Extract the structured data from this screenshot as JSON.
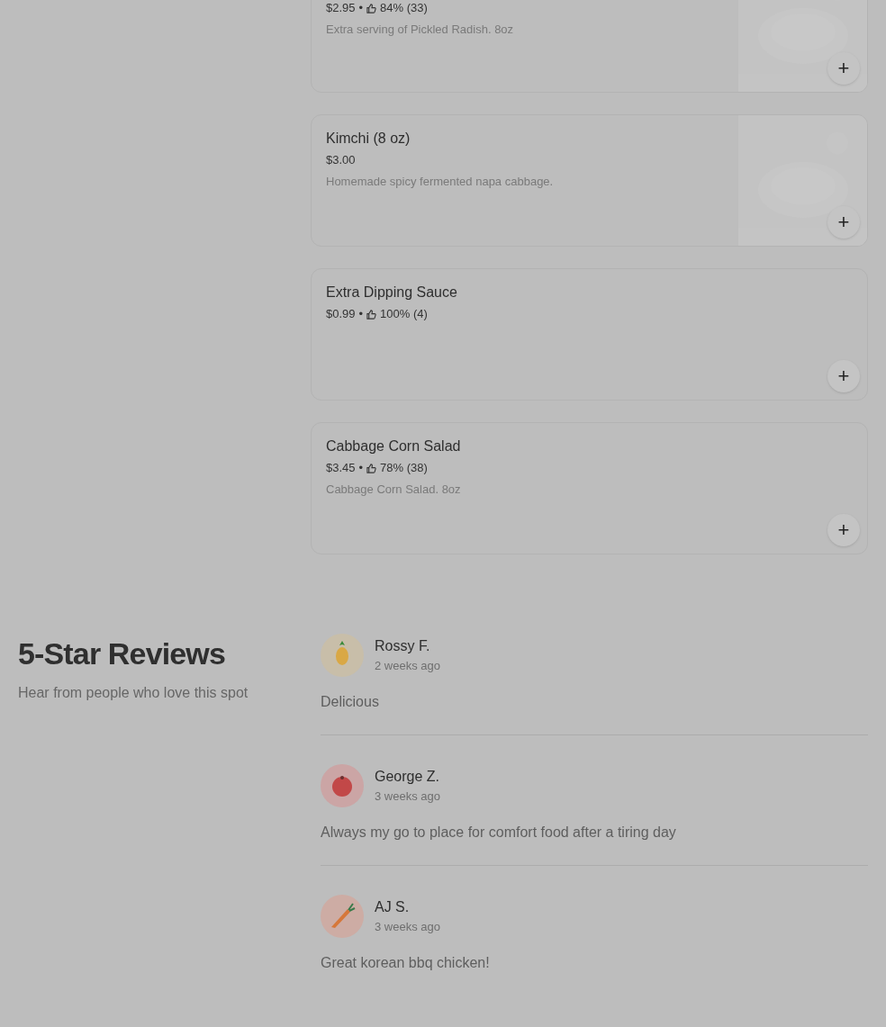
{
  "menu_items": [
    {
      "cut_top": true,
      "price": "$2.95",
      "rating": {
        "separator": "•",
        "value": "84% (33)"
      },
      "description": "Extra serving of Pickled Radish. 8oz",
      "add_label": "+"
    },
    {
      "cut_top": false,
      "name": "Kimchi (8 oz)",
      "price": "$3.00",
      "description": "Homemade spicy fermented napa cabbage.",
      "add_label": "+"
    },
    {
      "cut_top": false,
      "name": "Extra Dipping Sauce",
      "price": "$0.99",
      "rating": {
        "separator": "•",
        "value": "100% (4)"
      },
      "add_label": "+"
    },
    {
      "cut_top": false,
      "name": "Cabbage Corn Salad",
      "price": "$3.45",
      "rating": {
        "separator": "•",
        "value": "78% (38)"
      },
      "description": "Cabbage Corn Salad. 8oz",
      "add_label": "+"
    }
  ],
  "reviews_section": {
    "title": "5-Star Reviews",
    "subtitle": "Hear from people who love this spot",
    "reviews": [
      {
        "name": "Rossy F.",
        "time": "2 weeks ago",
        "kind": "pineapple",
        "color": "#c8bea9",
        "text": "Delicious"
      },
      {
        "name": "George Z.",
        "time": "3 weeks ago",
        "kind": "tomato",
        "color": "#cba5a5",
        "text": "Always my go to place for comfort food after a tiring day"
      },
      {
        "name": "AJ S.",
        "time": "3 weeks ago",
        "kind": "carrot",
        "color": "#cdaca4",
        "text": "Great korean bbq chicken!"
      }
    ]
  }
}
